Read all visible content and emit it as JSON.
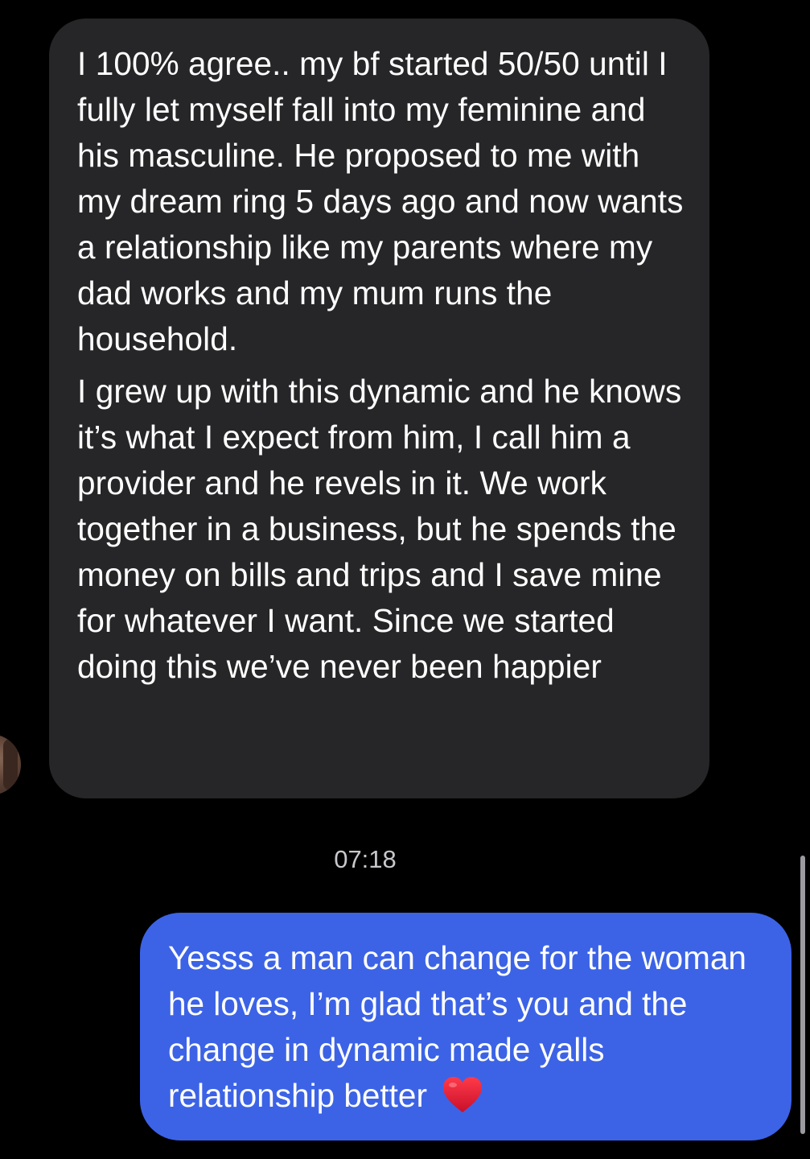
{
  "conversation": {
    "incoming_message": {
      "paragraph_1": "I 100% agree.. my bf started 50/50 until I fully let myself fall into my feminine and his masculine. He proposed to me with my dream ring 5 days ago and now wants a relationship like my parents where my dad works and my mum runs the household.",
      "paragraph_2": "I grew up with this dynamic and he knows it’s what I expect from him, I call him a provider and he revels in it. We work together in a business, but he spends the money on bills and trips and I save mine for whatever I want. Since we started doing this we’ve never been happier"
    },
    "timestamp": "07:18",
    "outgoing_message": {
      "text": "Yesss a man can change for the woman he loves, I’m glad that’s you and the change in dynamic made yalls relationship better",
      "emoji": "heart-icon"
    }
  },
  "colors": {
    "background": "#000000",
    "incoming_bubble": "#262628",
    "outgoing_bubble": "#3c63e6",
    "timestamp_text": "#c7c7cc",
    "heart": "#e0142c"
  }
}
